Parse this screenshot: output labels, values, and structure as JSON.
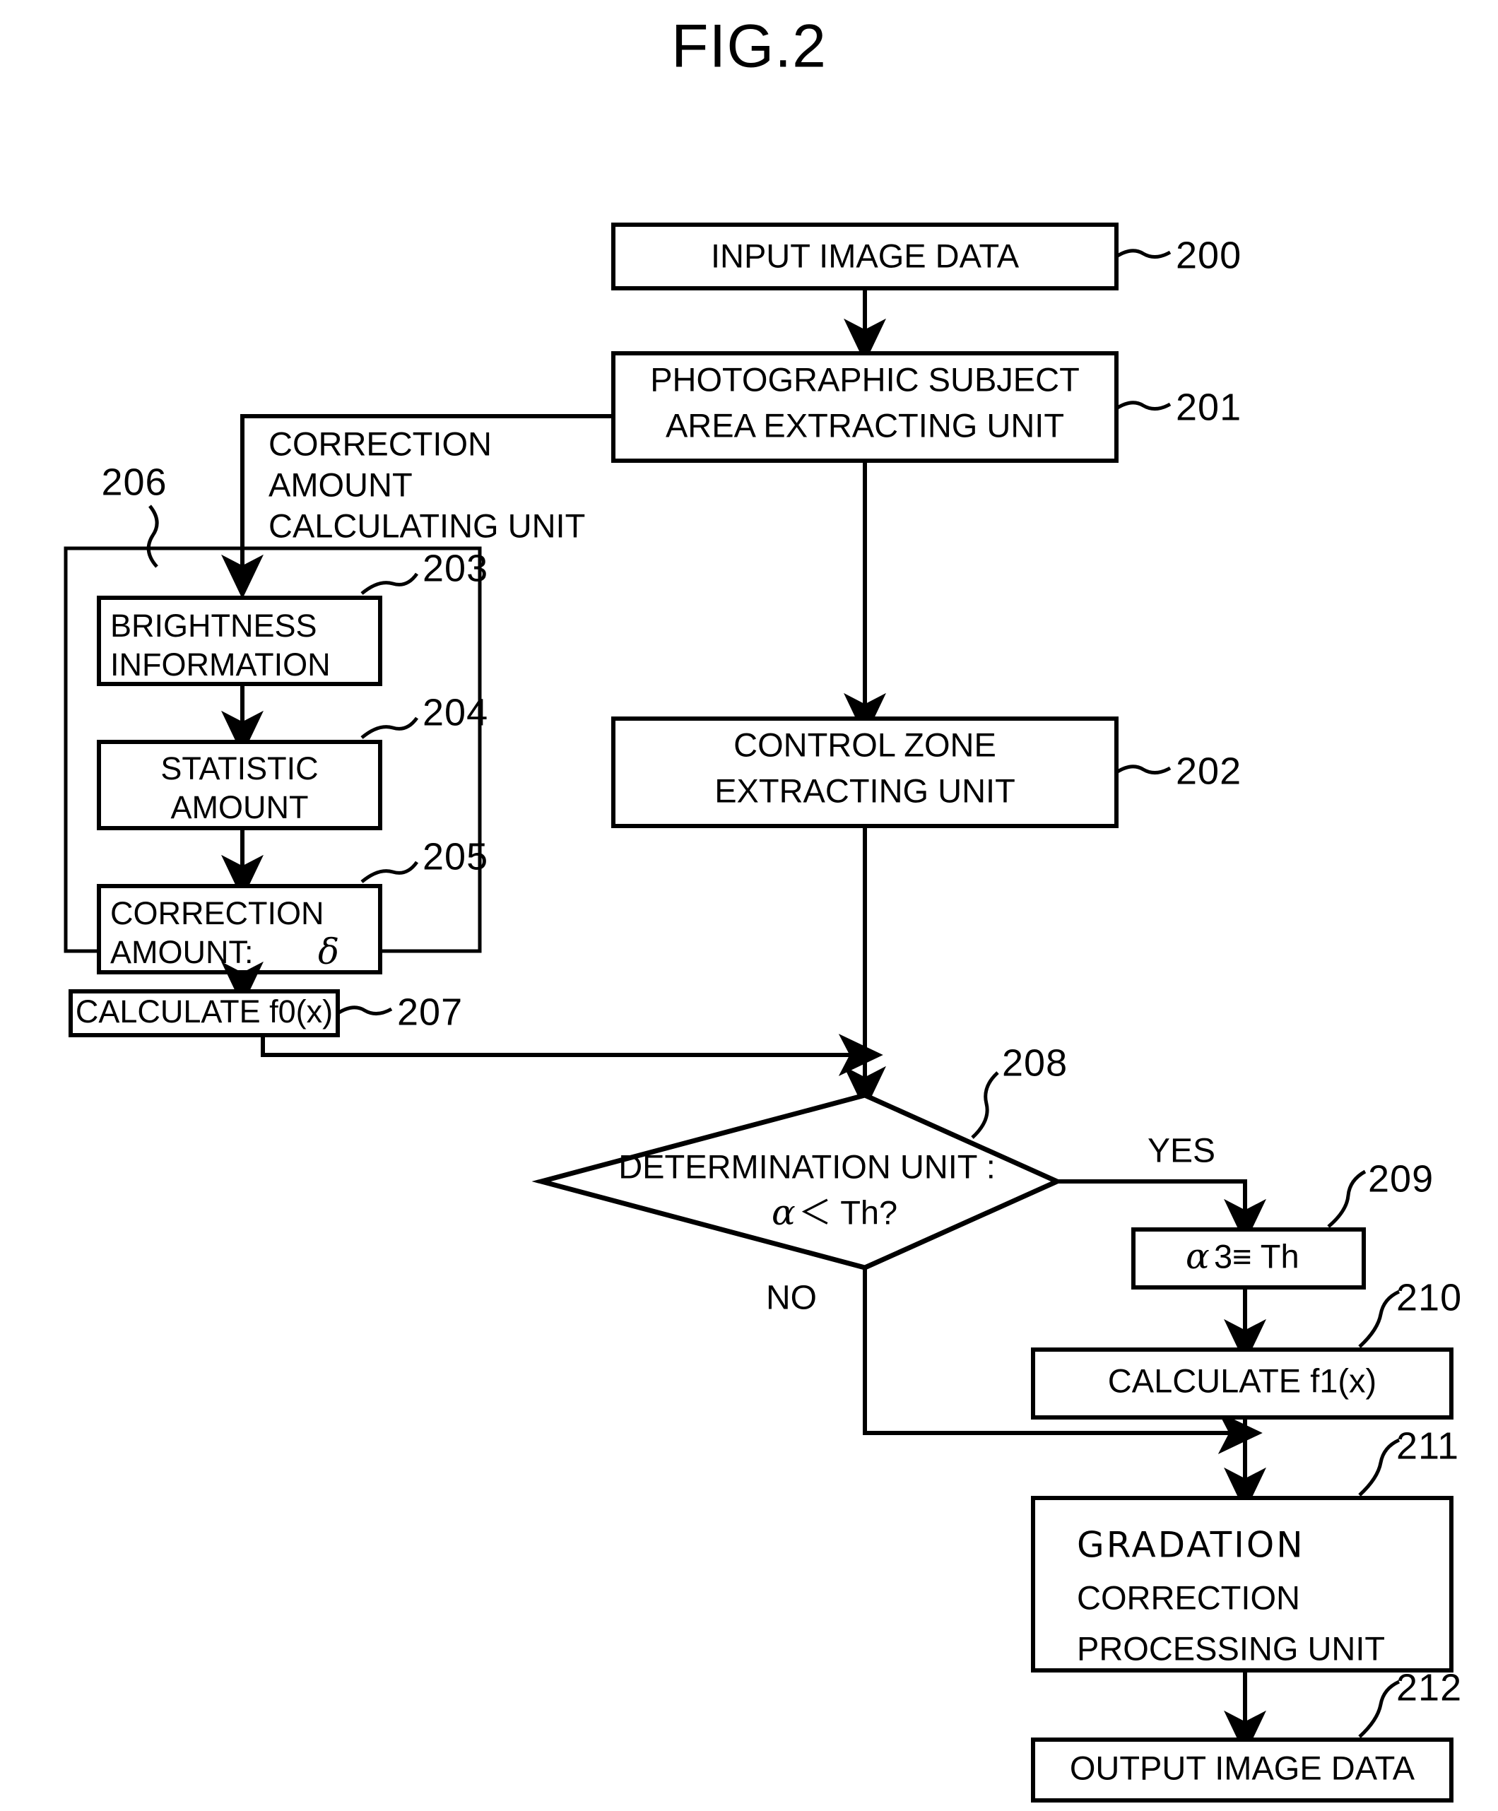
{
  "figure": {
    "title": "FIG.2",
    "type": "patent-flowchart"
  },
  "nodes": {
    "input": {
      "ref": "200",
      "label": "INPUT IMAGE DATA"
    },
    "subject_extract": {
      "ref": "201",
      "line1": "PHOTOGRAPHIC SUBJECT",
      "line2": "AREA EXTRACTING UNIT"
    },
    "control_zone": {
      "ref": "202",
      "line1": "CONTROL ZONE",
      "line2": "EXTRACTING UNIT"
    },
    "brightness": {
      "ref": "203",
      "line1": "BRIGHTNESS",
      "line2": "INFORMATION"
    },
    "statistic": {
      "ref": "204",
      "line1": "STATISTIC",
      "line2": "AMOUNT"
    },
    "correction_amount": {
      "ref": "205",
      "line1": "CORRECTION",
      "line2": "AMOUNT:",
      "symbol": "δ"
    },
    "correction_unit_group": {
      "ref": "206",
      "caption_line1": "CORRECTION",
      "caption_line2": "AMOUNT",
      "caption_line3": "CALCULATING UNIT"
    },
    "calc_f0": {
      "ref": "207",
      "label": "CALCULATE f0(x)"
    },
    "determination": {
      "ref": "208",
      "line1": "DETERMINATION UNIT :",
      "condition_alpha": "α",
      "condition_rest": "＜ Th?"
    },
    "assign_th": {
      "ref": "209",
      "alpha": "α",
      "rest": "3≡ Th"
    },
    "calc_f1": {
      "ref": "210",
      "label": "CALCULATE f1(x)"
    },
    "gradation": {
      "ref": "211",
      "line1": "GRADATION",
      "line2": "CORRECTION",
      "line3": "PROCESSING UNIT"
    },
    "output": {
      "ref": "212",
      "label": "OUTPUT IMAGE DATA"
    }
  },
  "branches": {
    "yes": "YES",
    "no": "NO"
  },
  "colors": {
    "ink": "#000000",
    "paper": "#ffffff"
  }
}
